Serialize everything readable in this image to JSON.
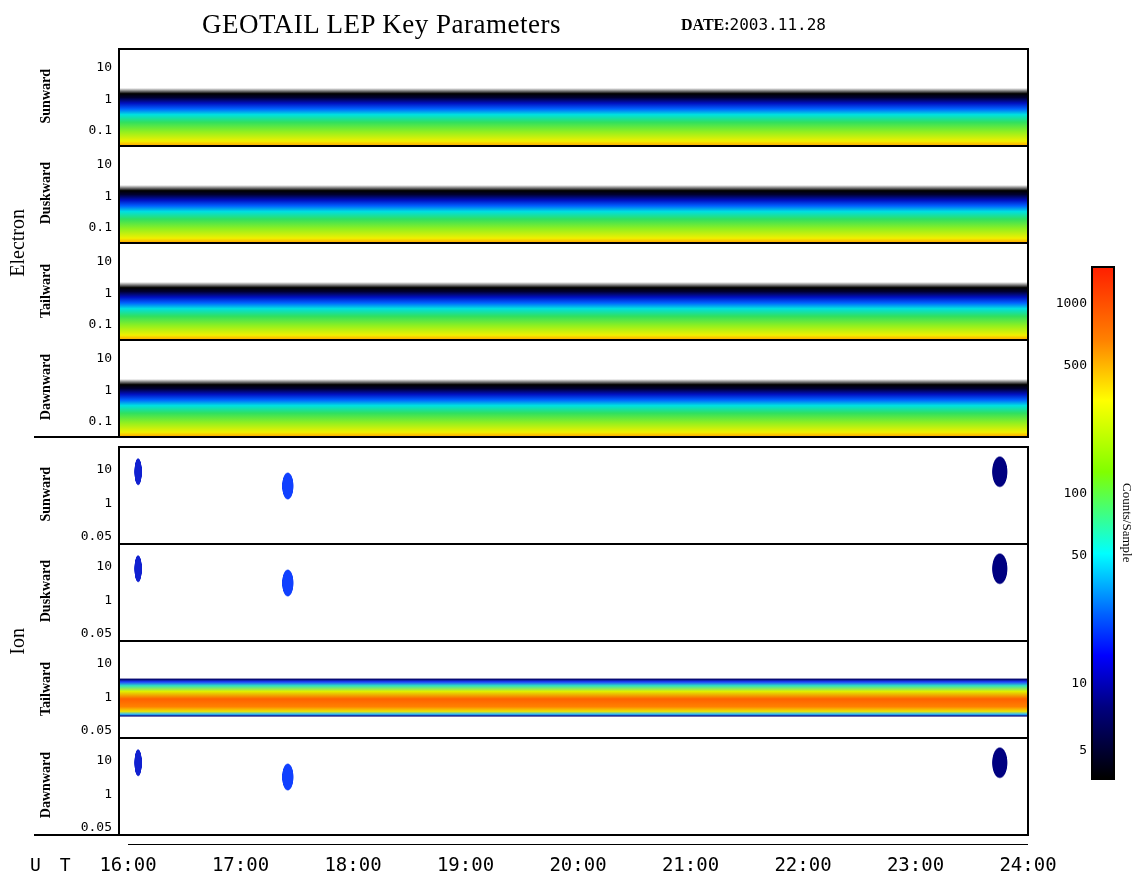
{
  "title": "GEOTAIL LEP Key Parameters",
  "date": {
    "label": "DATE:",
    "value": "2003.11.28"
  },
  "groups": [
    {
      "name": "Electron",
      "panels": [
        {
          "name": "Sunward",
          "kind": "electron",
          "yticks": [
            "10",
            "1",
            "0.1"
          ]
        },
        {
          "name": "Duskward",
          "kind": "electron",
          "yticks": [
            "10",
            "1",
            "0.1"
          ]
        },
        {
          "name": "Tailward",
          "kind": "electron",
          "yticks": [
            "10",
            "1",
            "0.1"
          ]
        },
        {
          "name": "Dawnward",
          "kind": "electron",
          "yticks": [
            "10",
            "1",
            "0.1"
          ]
        }
      ]
    },
    {
      "name": "Ion",
      "panels": [
        {
          "name": "Sunward",
          "kind": "sparse",
          "yticks": [
            "10",
            "1",
            "0.05"
          ]
        },
        {
          "name": "Duskward",
          "kind": "sparse",
          "yticks": [
            "10",
            "1",
            "0.05"
          ]
        },
        {
          "name": "Tailward",
          "kind": "band",
          "yticks": [
            "10",
            "1",
            "0.05"
          ]
        },
        {
          "name": "Dawnward",
          "kind": "sparse",
          "yticks": [
            "10",
            "1",
            "0.05"
          ]
        }
      ]
    }
  ],
  "time_axis": {
    "label": "U T",
    "ticks": [
      "16:00",
      "17:00",
      "18:00",
      "19:00",
      "20:00",
      "21:00",
      "22:00",
      "23:00",
      "24:00"
    ]
  },
  "colorbar": {
    "label": "Counts/Sample",
    "ticks": [
      "1000",
      "500",
      "100",
      "50",
      "10",
      "5"
    ]
  }
}
